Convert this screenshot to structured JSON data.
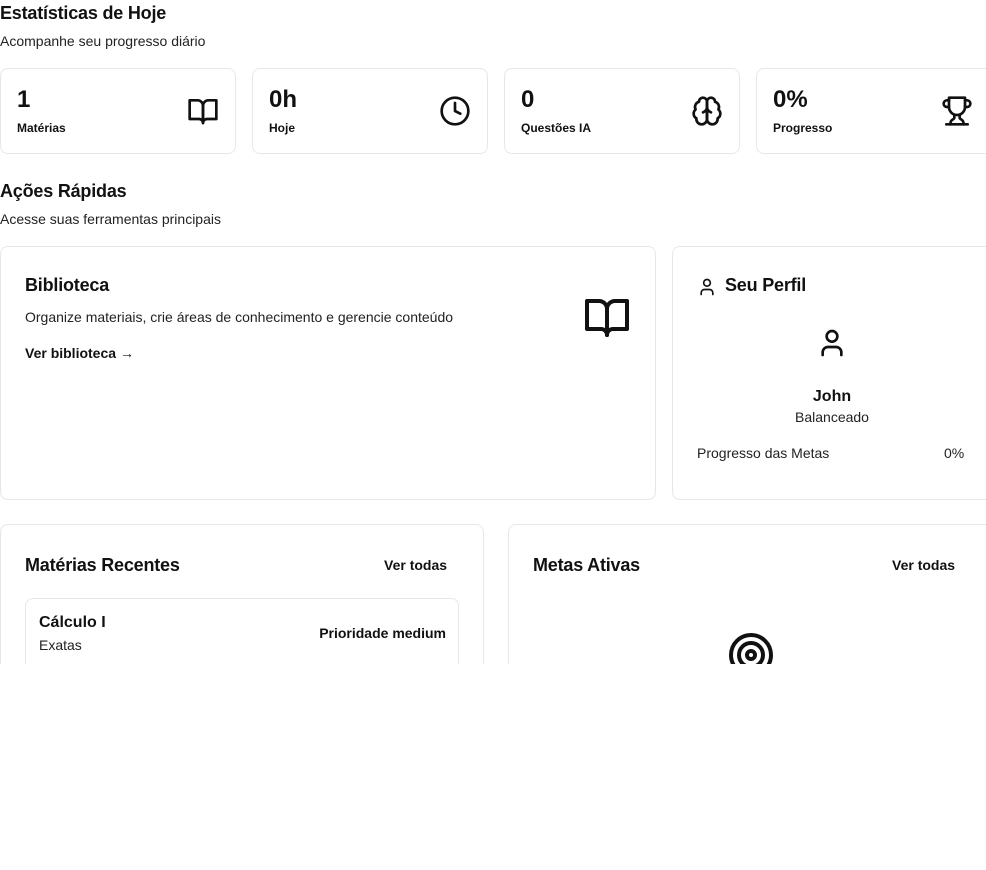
{
  "stats_section": {
    "title": "Estatísticas de Hoje",
    "subtitle": "Acompanhe seu progresso diário",
    "cards": [
      {
        "value": "1",
        "label": "Matérias",
        "icon": "book-open-icon"
      },
      {
        "value": "0h",
        "label": "Hoje",
        "icon": "clock-icon"
      },
      {
        "value": "0",
        "label": "Questões IA",
        "icon": "brain-icon"
      },
      {
        "value": "0%",
        "label": "Progresso",
        "icon": "trophy-icon"
      }
    ]
  },
  "quick_actions": {
    "title": "Ações Rápidas",
    "subtitle": "Acesse suas ferramentas principais",
    "library": {
      "title": "Biblioteca",
      "description": "Organize materiais, crie áreas de conhecimento e gerencie conteúdo",
      "link": "Ver biblioteca",
      "link_arrow": "→"
    },
    "profile": {
      "title": "Seu Perfil",
      "name": "John",
      "mode": "Balanceado",
      "goal_progress_label": "Progresso das Metas",
      "goal_progress_value": "0%"
    }
  },
  "recent_subjects": {
    "title": "Matérias Recentes",
    "view_all": "Ver todas",
    "items": [
      {
        "name": "Cálculo I",
        "area": "Exatas",
        "priority": "Prioridade medium"
      }
    ]
  },
  "active_goals": {
    "title": "Metas Ativas",
    "view_all": "Ver todas",
    "empty_icon": "target-icon"
  }
}
